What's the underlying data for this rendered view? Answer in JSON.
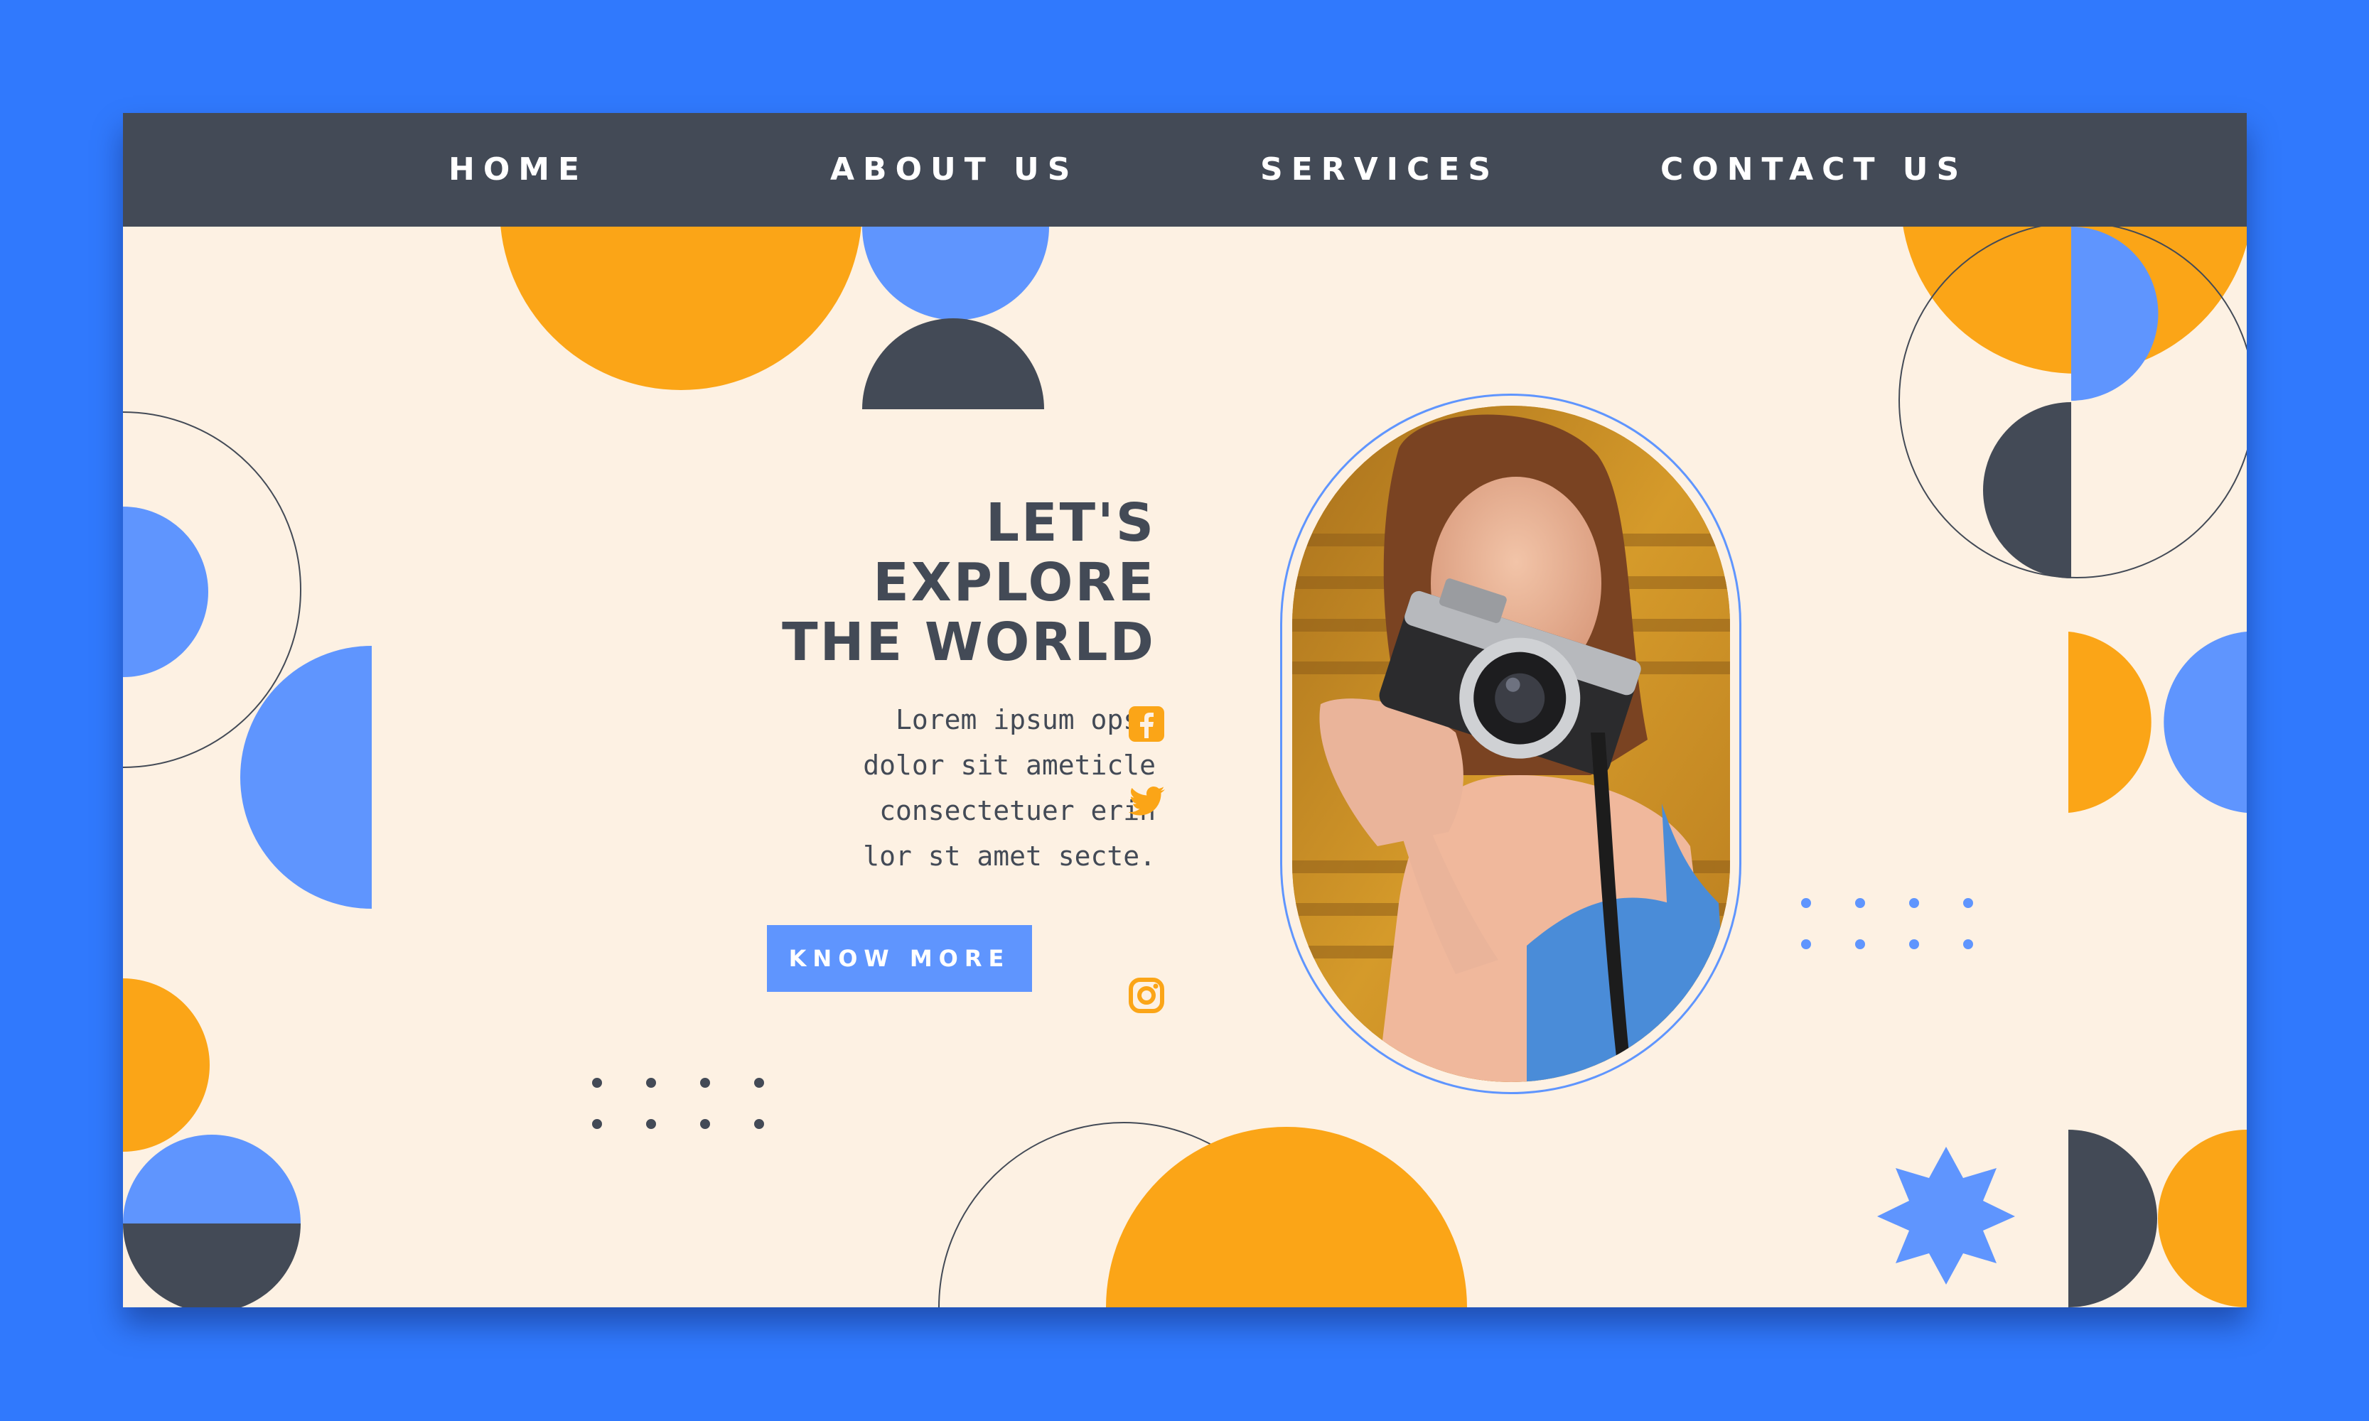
{
  "nav": {
    "items": [
      {
        "label": "HOME"
      },
      {
        "label": "ABOUT US"
      },
      {
        "label": "SERVICES"
      },
      {
        "label": "CONTACT US"
      }
    ]
  },
  "hero": {
    "title_lines": [
      "LET'S",
      "EXPLORE",
      "THE WORLD"
    ],
    "body_lines": [
      "Lorem ipsum opsc",
      "dolor sit ameticle",
      "consectetuer erin",
      "lor st amet secte."
    ],
    "button_label": "KNOW MORE"
  },
  "social_icons": [
    "facebook-icon",
    "twitter-icon",
    "instagram-icon"
  ],
  "colors": {
    "background": "#3079fd",
    "page": "#fdf1e3",
    "nav": "#434a56",
    "orange": "#fba517",
    "blue": "#5f95fe",
    "dark": "#434a56"
  }
}
